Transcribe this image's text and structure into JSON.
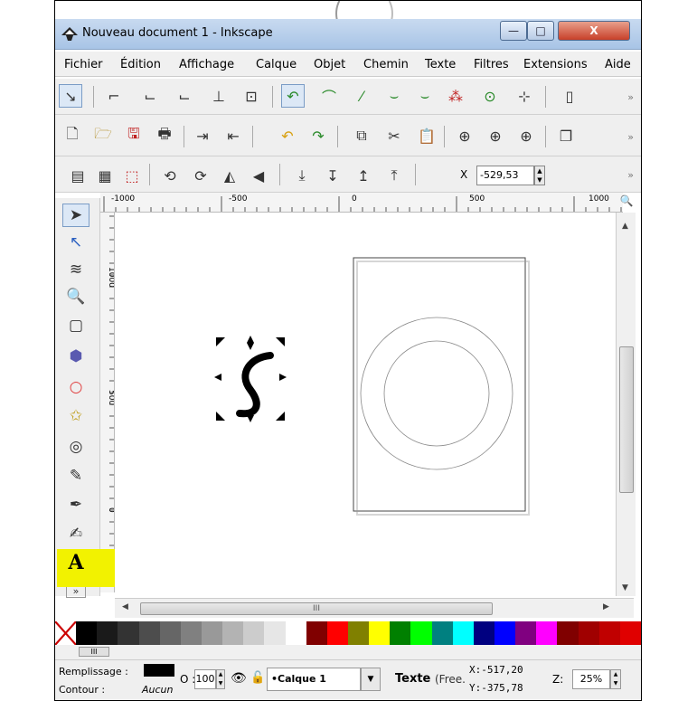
{
  "window": {
    "title": "Nouveau document 1 - Inkscape",
    "min": "—",
    "max": "□",
    "close": "X"
  },
  "menu": [
    "Fichier",
    "Édition",
    "Affichage",
    "Calque",
    "Objet",
    "Chemin",
    "Texte",
    "Filtres",
    "Extensions",
    "Aide"
  ],
  "toolbar3": {
    "x_label": "X",
    "x_value": "-529,53"
  },
  "ruler_h": [
    "-1000",
    "-500",
    "0",
    "500",
    "1000"
  ],
  "ruler_v": [
    "1000",
    "500",
    "0"
  ],
  "palette": [
    "#000000",
    "#1a1a1a",
    "#333333",
    "#4d4d4d",
    "#666666",
    "#808080",
    "#999999",
    "#b3b3b3",
    "#cccccc",
    "#e6e6e6",
    "#ffffff",
    "#800000",
    "#ff0000",
    "#808000",
    "#ffff00",
    "#008000",
    "#00ff00",
    "#008080",
    "#00ffff",
    "#000080",
    "#0000ff",
    "#800080",
    "#ff00ff",
    "#800000",
    "#a00000",
    "#c00000",
    "#e00000"
  ],
  "status": {
    "fill_label": "Remplissage :",
    "stroke_label": "Contour :",
    "stroke_value": "Aucun",
    "opacity_label": "O :",
    "opacity_value": "100",
    "layer": "•Calque 1",
    "tool_text": "Texte",
    "tool_suffix": "(Free.",
    "x_coord": "X:-517,20",
    "y_coord": "Y:-375,78",
    "zoom_label": "Z:",
    "zoom_value": "25%"
  },
  "colors": {
    "highlight": "#f2f200",
    "titlebar": "#b8cee8"
  }
}
